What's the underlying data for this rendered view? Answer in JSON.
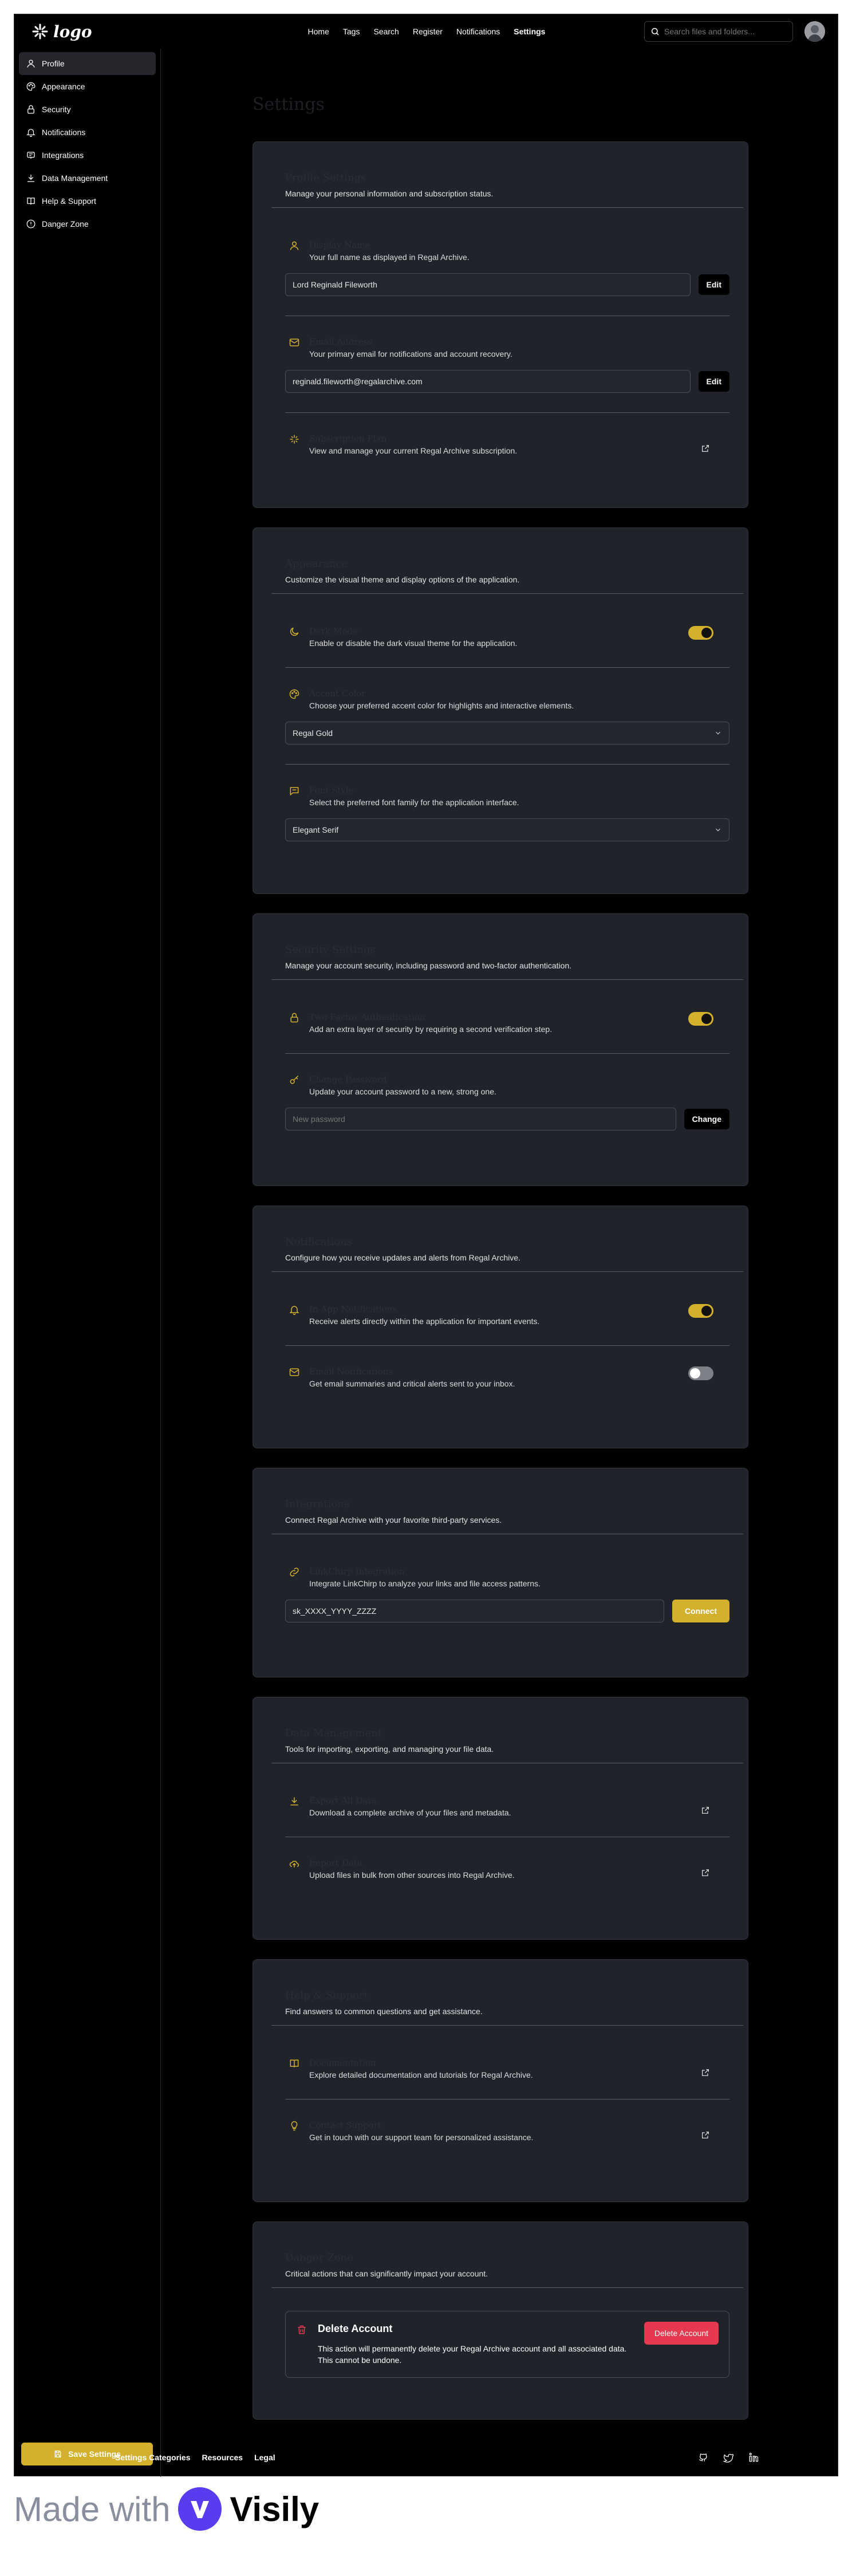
{
  "app": {
    "logo_text": "logo"
  },
  "nav": [
    "Home",
    "Tags",
    "Search",
    "Register",
    "Notifications",
    "Settings"
  ],
  "nav_active": "Settings",
  "search": {
    "placeholder": "Search files and folders..."
  },
  "sidebar": {
    "items": [
      {
        "label": "Profile",
        "icon": "user-icon",
        "active": true
      },
      {
        "label": "Appearance",
        "icon": "palette-icon"
      },
      {
        "label": "Security",
        "icon": "lock-icon"
      },
      {
        "label": "Notifications",
        "icon": "bell-icon"
      },
      {
        "label": "Integrations",
        "icon": "plug-icon"
      },
      {
        "label": "Data Management",
        "icon": "download-icon"
      },
      {
        "label": "Help & Support",
        "icon": "book-icon"
      },
      {
        "label": "Danger Zone",
        "icon": "alert-icon"
      }
    ],
    "save_label": "Save Settings"
  },
  "page": {
    "title": "Settings"
  },
  "profile": {
    "title": "Profile Settings",
    "desc": "Manage your personal information and subscription status.",
    "name": {
      "title": "Display Name",
      "desc": "Your full name as displayed in Regal Archive.",
      "value": "Lord Reginald Fileworth",
      "button": "Edit"
    },
    "email": {
      "title": "Email Address",
      "desc": "Your primary email for notifications and account recovery.",
      "value": "reginald.fileworth@regalarchive.com",
      "button": "Edit"
    },
    "subscription": {
      "title": "Subscription Plan",
      "desc": "View and manage your current Regal Archive subscription."
    }
  },
  "appearance": {
    "title": "Appearance",
    "desc": "Customize the visual theme and display options of the application.",
    "dark_mode": {
      "title": "Dark Mode",
      "desc": "Enable or disable the dark visual theme for the application.",
      "on": true
    },
    "accent": {
      "title": "Accent Color",
      "desc": "Choose your preferred accent color for highlights and interactive elements.",
      "value": "Regal Gold"
    },
    "font": {
      "title": "Font Style",
      "desc": "Select the preferred font family for the application interface.",
      "value": "Elegant Serif"
    }
  },
  "security": {
    "title": "Security Settings",
    "desc": "Manage your account security, including password and two-factor authentication.",
    "two_factor": {
      "title": "Two-Factor Authentication",
      "desc": "Add an extra layer of security by requiring a second verification step.",
      "on": true
    },
    "password": {
      "title": "Change Password",
      "desc": "Update your account password to a new, strong one.",
      "placeholder": "New password",
      "button": "Change"
    }
  },
  "notifications": {
    "title": "Notifications",
    "desc": "Configure how you receive updates and alerts from Regal Archive.",
    "in_app": {
      "title": "In-App Notifications",
      "desc": "Receive alerts directly within the application for important events.",
      "on": true
    },
    "email": {
      "title": "Email Notifications",
      "desc": "Get email summaries and critical alerts sent to your inbox.",
      "on": false
    }
  },
  "integrations": {
    "title": "Integrations",
    "desc": "Connect Regal Archive with your favorite third-party services.",
    "linkchirp": {
      "title": "LinkChirp Integration",
      "desc": "Integrate LinkChirp to analyze your links and file access patterns.",
      "value": "sk_XXXX_YYYY_ZZZZ",
      "button": "Connect"
    }
  },
  "data": {
    "title": "Data Management",
    "desc": "Tools for importing, exporting, and managing your file data.",
    "export": {
      "title": "Export All Data",
      "desc": "Download a complete archive of your files and metadata."
    },
    "import": {
      "title": "Import Data",
      "desc": "Upload files in bulk from other sources into Regal Archive."
    }
  },
  "help": {
    "title": "Help & Support",
    "desc": "Find answers to common questions and get assistance.",
    "docs": {
      "title": "Documentation",
      "desc": "Explore detailed documentation and tutorials for Regal Archive."
    },
    "contact": {
      "title": "Contact Support",
      "desc": "Get in touch with our support team for personalized assistance."
    }
  },
  "danger": {
    "title": "Danger Zone",
    "desc": "Critical actions that can significantly impact your account.",
    "delete_title": "Delete Account",
    "delete_desc": "This action will permanently delete your Regal Archive account and all associated data. This cannot be undone.",
    "delete_button": "Delete Account"
  },
  "footer": {
    "links": [
      "Settings Categories",
      "Resources",
      "Legal"
    ],
    "icons": [
      "github-icon",
      "twitter-icon",
      "linkedin-icon"
    ]
  },
  "watermark": {
    "made_with": "Made with",
    "brand": "Visily"
  },
  "colors": {
    "accent": "#d4b12c",
    "danger": "#e53950",
    "card": "#20232a",
    "background": "#000000"
  }
}
